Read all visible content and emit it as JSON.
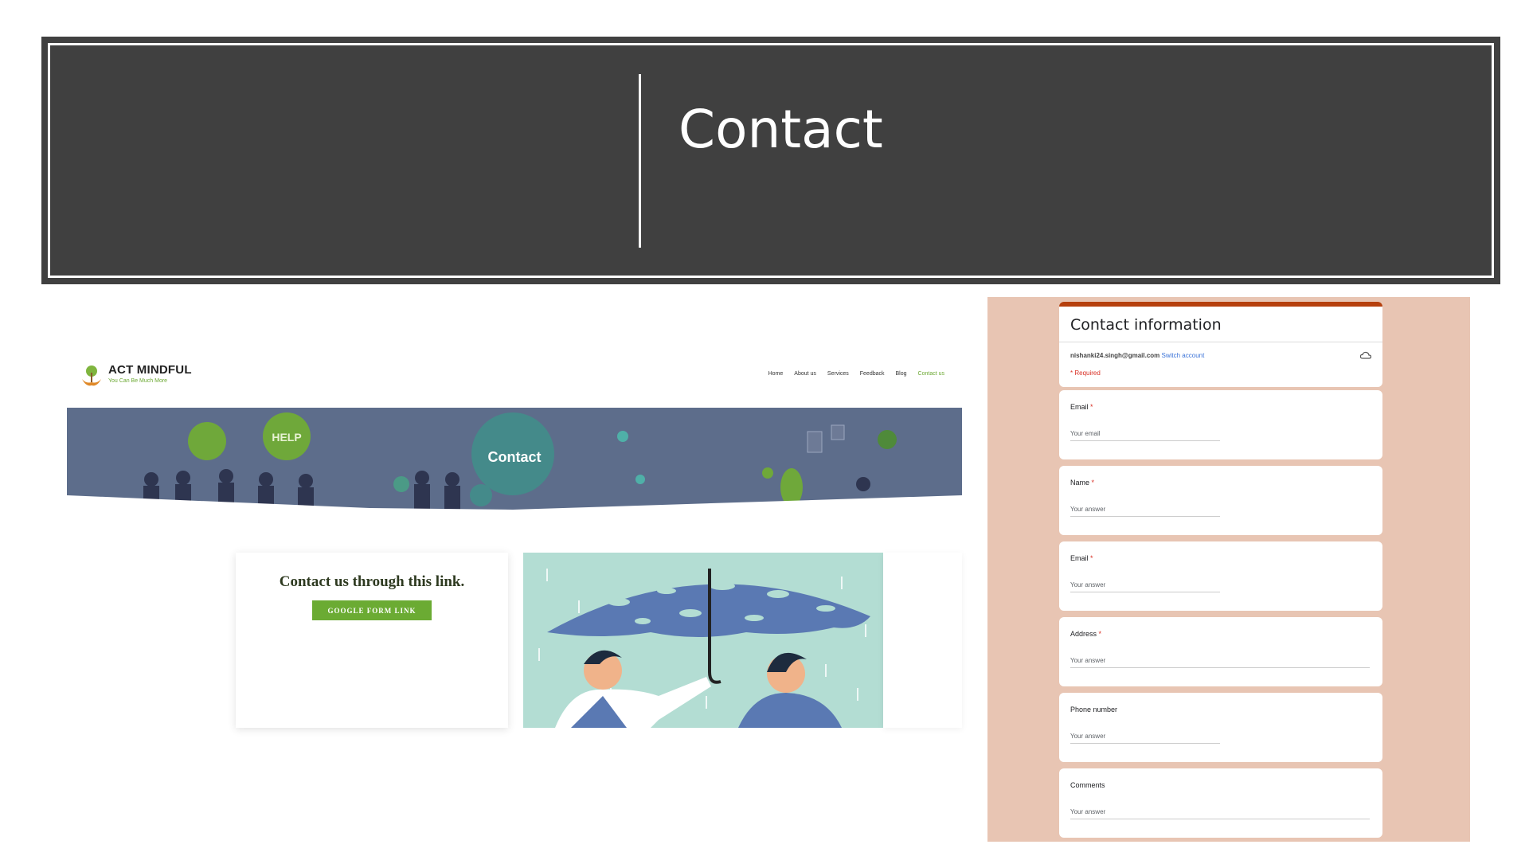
{
  "slide": {
    "title": "Contact"
  },
  "site": {
    "logo_title": "ACT MINDFUL",
    "logo_tagline": "You Can Be Much More",
    "nav": [
      "Home",
      "About us",
      "Services",
      "Feedback",
      "Blog",
      "Contact us"
    ],
    "hero_title": "Contact",
    "hero_help": "HELP",
    "card_heading": "Contact us through this link.",
    "button_label": "GOOGLE FORM LINK"
  },
  "form": {
    "title": "Contact information",
    "account_email": "nishanki24.singh@gmail.com",
    "switch_label": "Switch account",
    "required_note": "* Required",
    "questions": [
      {
        "label": "Email",
        "required": "*",
        "placeholder": "Your email"
      },
      {
        "label": "Name",
        "required": "*",
        "placeholder": "Your answer"
      },
      {
        "label": "Email",
        "required": "*",
        "placeholder": "Your answer"
      },
      {
        "label": "Address",
        "required": "*",
        "placeholder": "Your answer"
      },
      {
        "label": "Phone number",
        "required": "",
        "placeholder": "Your answer"
      },
      {
        "label": "Comments",
        "required": "",
        "placeholder": "Your answer"
      }
    ]
  },
  "colors": {
    "banner": "#404040",
    "accent_green": "#6bab33",
    "form_bg": "#e8c5b3",
    "form_header": "#b6400d"
  }
}
